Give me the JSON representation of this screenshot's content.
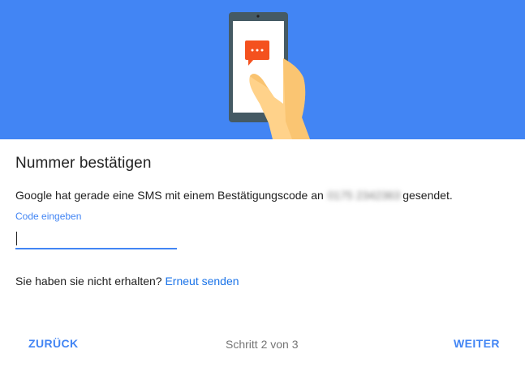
{
  "header": {
    "illustration": "phone-with-sms-illustration",
    "background_color": "#4285f4"
  },
  "dialog": {
    "title": "Nummer bestätigen",
    "description_prefix": "Google hat gerade eine SMS mit einem Bestätigungscode an",
    "phone_number": "0175 2342363",
    "description_suffix": "gesendet.",
    "code_field": {
      "label": "Code eingeben",
      "value": "",
      "placeholder": ""
    },
    "resend_prompt": "Sie haben sie nicht erhalten?",
    "resend_link": "Erneut senden"
  },
  "footer": {
    "back_label": "ZURÜCK",
    "step_text": "Schritt 2 von 3",
    "next_label": "WEITER"
  },
  "colors": {
    "accent": "#4285f4",
    "sms_icon": "#f4511e",
    "text": "#212121",
    "muted": "#757575"
  }
}
